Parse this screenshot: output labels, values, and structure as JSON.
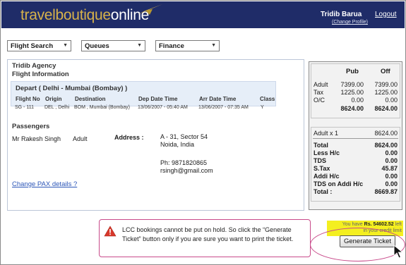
{
  "header": {
    "logo_part1": "travelboutique",
    "logo_part2": "online",
    "user_name": "Tridib  Barua",
    "logout": "Logout",
    "change_profile": "(Change Profile)"
  },
  "menus": [
    {
      "label": "Flight Search"
    },
    {
      "label": "Queues"
    },
    {
      "label": "Finance"
    }
  ],
  "agency": {
    "name": "Tridib Agency",
    "section": "Flight Information"
  },
  "flight": {
    "title": "Depart ( Delhi - Mumbai (Bombay) )",
    "headers": [
      "Flight No",
      "Origin",
      "Destination",
      "Dep Date Time",
      "Arr Date Time",
      "Class"
    ],
    "row": [
      "SG - 111",
      "DEL , Delhi",
      "BOM , Mumbai (Bombay)",
      "13/06/2007 - 05:40 AM",
      "13/06/2007 - 07:35 AM",
      "Y"
    ]
  },
  "passengers": {
    "label": "Passengers",
    "name": "Mr Rakesh Singh",
    "type": "Adult",
    "address_label": "Address :",
    "address_line1": "A - 31, Sector 54",
    "address_line2": "Noida, India",
    "phone": "Ph: 9871820865",
    "email": "rsingh@gmail.com",
    "change_link": "Change PAX details ?"
  },
  "fare": {
    "col_pub": "Pub",
    "col_off": "Off",
    "rows": [
      {
        "label": "Adult",
        "pub": "7399.00",
        "off": "7399.00"
      },
      {
        "label": "Tax",
        "pub": "1225.00",
        "off": "1225.00"
      },
      {
        "label": "O/C",
        "pub": "0.00",
        "off": "0.00"
      }
    ],
    "total_pub": "8624.00",
    "total_off": "8624.00",
    "breakdown_label": "Adult x 1",
    "breakdown_value": "8624.00",
    "summary": [
      {
        "label": "Total",
        "value": "8624.00"
      },
      {
        "label": "Less H/c",
        "value": "0.00"
      },
      {
        "label": "TDS",
        "value": "0.00"
      },
      {
        "label": "S.Tax",
        "value": "45.87"
      },
      {
        "label": "Addi H/c",
        "value": "0.00"
      },
      {
        "label": "TDS on Addi H/c",
        "value": "0.00"
      },
      {
        "label": "Total :",
        "value": "8669.87"
      }
    ]
  },
  "warning": {
    "text": "LCC bookings cannot be put on hold. So click the “Generate Ticket” button only if you are sure you want to print the ticket."
  },
  "credit": {
    "prefix": "You have ",
    "amount": "Rs. 54602.52",
    "suffix": " left",
    "line2": "in your credit limit"
  },
  "generate_button": "Generate Ticket",
  "colors": {
    "header_bg": "#1f2c68",
    "logo_gold": "#d7b24a",
    "highlight": "#f4ef20",
    "callout_border": "#c84a8a",
    "link": "#2c56b8"
  }
}
